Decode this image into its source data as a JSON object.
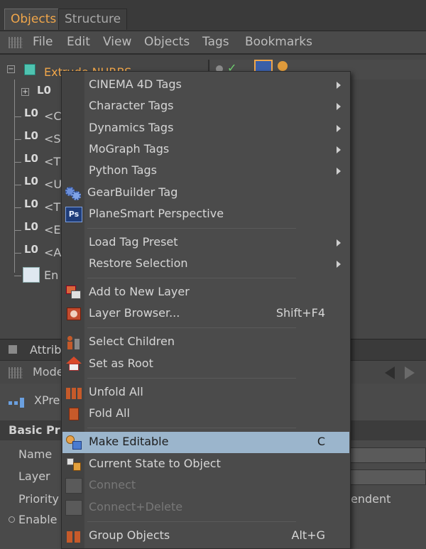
{
  "tabs": [
    "Objects",
    "Structure"
  ],
  "menubar": [
    "File",
    "Edit",
    "View",
    "Objects",
    "Tags",
    "Bookmarks"
  ],
  "objects": {
    "root": "Extrude NURBS",
    "children": [
      "<C",
      "<S",
      "<T",
      "<U",
      "<T",
      "<E",
      "<A"
    ],
    "last": "En"
  },
  "attributes": {
    "header": "Attrib",
    "mode": "Mode",
    "xpresso": "XPre",
    "basic": "Basic Pr",
    "fields": [
      "Name",
      "Layer",
      "Priority",
      "Enable"
    ],
    "priority_value": "endent"
  },
  "context_menu": {
    "items": [
      {
        "label": "CINEMA 4D Tags",
        "submenu": true,
        "icon": ""
      },
      {
        "label": "Character Tags",
        "submenu": true,
        "icon": ""
      },
      {
        "label": "Dynamics Tags",
        "submenu": true,
        "icon": ""
      },
      {
        "label": "MoGraph Tags",
        "submenu": true,
        "icon": ""
      },
      {
        "label": "Python Tags",
        "submenu": true,
        "icon": ""
      },
      {
        "label": "GearBuilder Tag",
        "submenu": false,
        "icon": "gears-icon"
      },
      {
        "label": "PlaneSmart Perspective",
        "submenu": false,
        "icon": "ps-icon"
      },
      {
        "label": "Load Tag Preset",
        "submenu": true,
        "icon": ""
      },
      {
        "label": "Restore Selection",
        "submenu": true,
        "icon": ""
      },
      {
        "label": "Add to New Layer",
        "submenu": false,
        "icon": "layer-add-icon"
      },
      {
        "label": "Layer Browser...",
        "shortcut": "Shift+F4",
        "icon": "layer-browser-icon"
      },
      {
        "label": "Select Children",
        "submenu": false,
        "icon": "select-children-icon"
      },
      {
        "label": "Set as Root",
        "submenu": false,
        "icon": "home-icon"
      },
      {
        "label": "Unfold All",
        "submenu": false,
        "icon": "unfold-icon"
      },
      {
        "label": "Fold All",
        "submenu": false,
        "icon": "fold-icon"
      },
      {
        "label": "Make Editable",
        "shortcut": "C",
        "icon": "make-editable-icon",
        "highlighted": true
      },
      {
        "label": "Current State to Object",
        "submenu": false,
        "icon": "current-state-icon"
      },
      {
        "label": "Connect",
        "disabled": true,
        "icon": "connect-icon"
      },
      {
        "label": "Connect+Delete",
        "disabled": true,
        "icon": "connect-delete-icon"
      },
      {
        "label": "Group Objects",
        "shortcut": "Alt+G",
        "icon": "group-icon"
      }
    ]
  },
  "colors": {
    "accent": "#f0a64a",
    "highlight": "#9bb5cc",
    "menu_bg": "#4b4b4b"
  }
}
